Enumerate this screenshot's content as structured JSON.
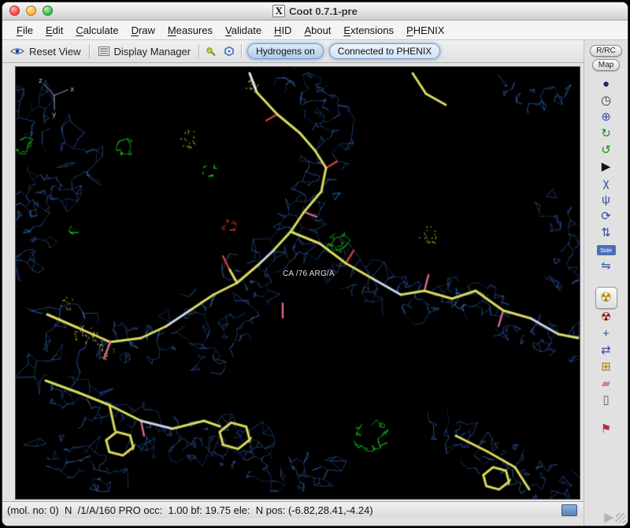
{
  "window": {
    "title": "Coot 0.7.1-pre",
    "icon_glyph": "X"
  },
  "menubar": {
    "items": [
      "File",
      "Edit",
      "Calculate",
      "Draw",
      "Measures",
      "Validate",
      "HID",
      "About",
      "Extensions",
      "PHENIX"
    ]
  },
  "toolbar": {
    "reset_view": "Reset View",
    "display_manager": "Display Manager",
    "hydrogens_button": "Hydrogens on",
    "phenix_button": "Connected to PHENIX"
  },
  "right_panel": {
    "rrc_button": "R/RC",
    "map_button": "Map",
    "console_glyph": "▶",
    "icons": [
      {
        "name": "globe-icon",
        "glyph": "●",
        "color": "#1c2f66"
      },
      {
        "name": "clock-icon",
        "glyph": "◷",
        "color": "#3a3a3a"
      },
      {
        "name": "center-atom-icon",
        "glyph": "⊕",
        "color": "#2a4ea0"
      },
      {
        "name": "rotate-zone-icon",
        "glyph": "↻",
        "color": "#159015"
      },
      {
        "name": "torsion-icon",
        "glyph": "↺",
        "color": "#159015"
      },
      {
        "name": "play-icon",
        "glyph": "▶",
        "color": "#101010"
      },
      {
        "name": "chi-angles-icon",
        "glyph": "χ",
        "color": "#2a4ea0"
      },
      {
        "name": "phi-psi-icon",
        "glyph": "ψ",
        "color": "#2a4ea0"
      },
      {
        "name": "rotamer-icon",
        "glyph": "⟳",
        "color": "#2a4ea0"
      },
      {
        "name": "flip-peptide-icon",
        "glyph": "⇅",
        "color": "#2a4ea0"
      },
      {
        "name": "side-chain-icon",
        "label": "Side",
        "color": "#4a6fb8"
      },
      {
        "name": "jed-flip-icon",
        "glyph": "⇋",
        "color": "#2a4ea0"
      },
      {
        "name": "real-space-refine-icon",
        "glyph": "☢",
        "color": "#b08c00",
        "highlight": true,
        "gap_before": true
      },
      {
        "name": "regularize-zone-icon",
        "glyph": "☢",
        "color": "#7a1010"
      },
      {
        "name": "rigid-body-icon",
        "glyph": "+",
        "color": "#2a4ea0"
      },
      {
        "name": "rotate-translate-icon",
        "glyph": "⇄",
        "color": "#2a4ea0"
      },
      {
        "name": "add-terminal-residue-icon",
        "glyph": "⊞",
        "color": "#a87800"
      },
      {
        "name": "eraser-icon",
        "glyph": "▰",
        "color": "#d878a8"
      },
      {
        "name": "trash-icon",
        "glyph": "▯",
        "color": "#555555"
      },
      {
        "name": "flag-icon",
        "glyph": "⚑",
        "color": "#b03040",
        "gap_before": true
      }
    ]
  },
  "statusbar": {
    "text": "(mol. no: 0)  N  /1/A/160 PRO occ:  1.00 bf: 19.75 ele:  N pos: (-6.82,28.41,-4.24)"
  },
  "canvas": {
    "atom_label": "CA /76 ARG/A",
    "axis_labels": {
      "x": "x",
      "y": "y",
      "z": "z"
    }
  },
  "colors": {
    "background": "#000000",
    "mesh_blue": "#2d6fe0",
    "model_yellow": "#d9d95c",
    "carbon_light": "#c8d2e2",
    "oxygen_red": "#d23b3b",
    "pink": "#e06890",
    "diff_positive_green": "#17c51c",
    "diff_negative_red": "#d03020",
    "dots_yellow": "#c8a828"
  }
}
